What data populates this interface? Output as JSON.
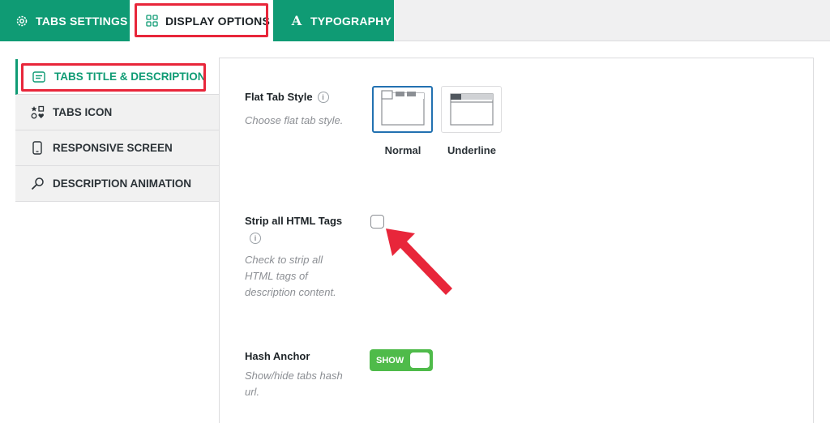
{
  "top_tabs": [
    {
      "label": "TABS SETTINGS",
      "icon": "gear-icon"
    },
    {
      "label": "DISPLAY OPTIONS",
      "icon": "grid-icon",
      "active": true
    },
    {
      "label": "TYPOGRAPHY",
      "icon": "typography-icon"
    }
  ],
  "sidebar": {
    "items": [
      {
        "label": "TABS TITLE & DESCRIPTION",
        "icon": "text-box-icon",
        "active": true
      },
      {
        "label": "TABS ICON",
        "icon": "shapes-icon"
      },
      {
        "label": "RESPONSIVE SCREEN",
        "icon": "mobile-icon"
      },
      {
        "label": "DESCRIPTION ANIMATION",
        "icon": "magic-wand-icon"
      }
    ]
  },
  "settings": {
    "flat_tab_style": {
      "label": "Flat Tab Style",
      "description": "Choose flat tab style.",
      "options": [
        "Normal",
        "Underline"
      ],
      "selected": "Normal"
    },
    "strip_html": {
      "label": "Strip all HTML Tags",
      "description_lines": [
        "Check to strip all",
        "HTML tags of",
        "description content."
      ],
      "checked": false
    },
    "hash_anchor": {
      "label": "Hash Anchor",
      "description_lines": [
        "Show/hide tabs hash",
        "url."
      ],
      "toggle_text": "SHOW",
      "enabled": true
    }
  },
  "colors": {
    "brand_green": "#0f9b74",
    "highlight_red": "#e8263a",
    "toggle_green": "#4fbb4a",
    "selected_blue": "#2271b1"
  }
}
